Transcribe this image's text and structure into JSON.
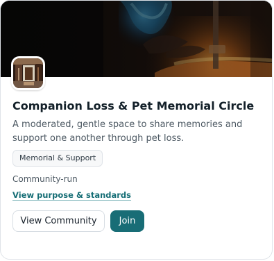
{
  "community": {
    "title": "Companion Loss & Pet Memorial Circle",
    "description": "A moderated, gentle space to share memories and support one another through pet loss.",
    "tag": "Memorial & Support",
    "status": "Community-run",
    "purpose_link": "View purpose & standards"
  },
  "actions": {
    "view_label": "View Community",
    "join_label": "Join"
  },
  "theme": {
    "accent": "#186d76",
    "link": "#156d75",
    "border": "#dfe3e8",
    "muted_text": "#4d5963"
  }
}
